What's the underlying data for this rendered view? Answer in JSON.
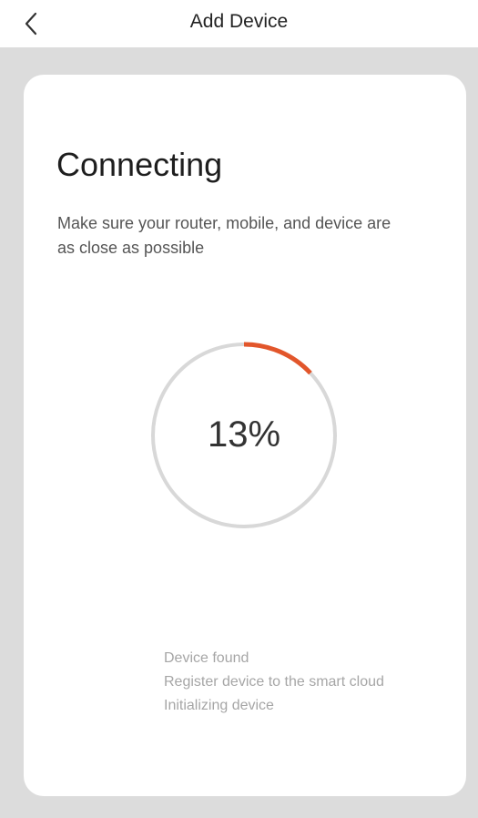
{
  "header": {
    "title": "Add Device",
    "back_icon": "chevron-left-icon"
  },
  "main": {
    "heading": "Connecting",
    "subtitle": "Make sure your router, mobile, and device are as close as possible",
    "progress": {
      "percent": 13,
      "label": "13%",
      "track_color": "#d8d8d8",
      "fill_color": "#e2562b"
    },
    "steps": [
      "Device found",
      "Register device to the smart cloud",
      "Initializing device"
    ]
  }
}
